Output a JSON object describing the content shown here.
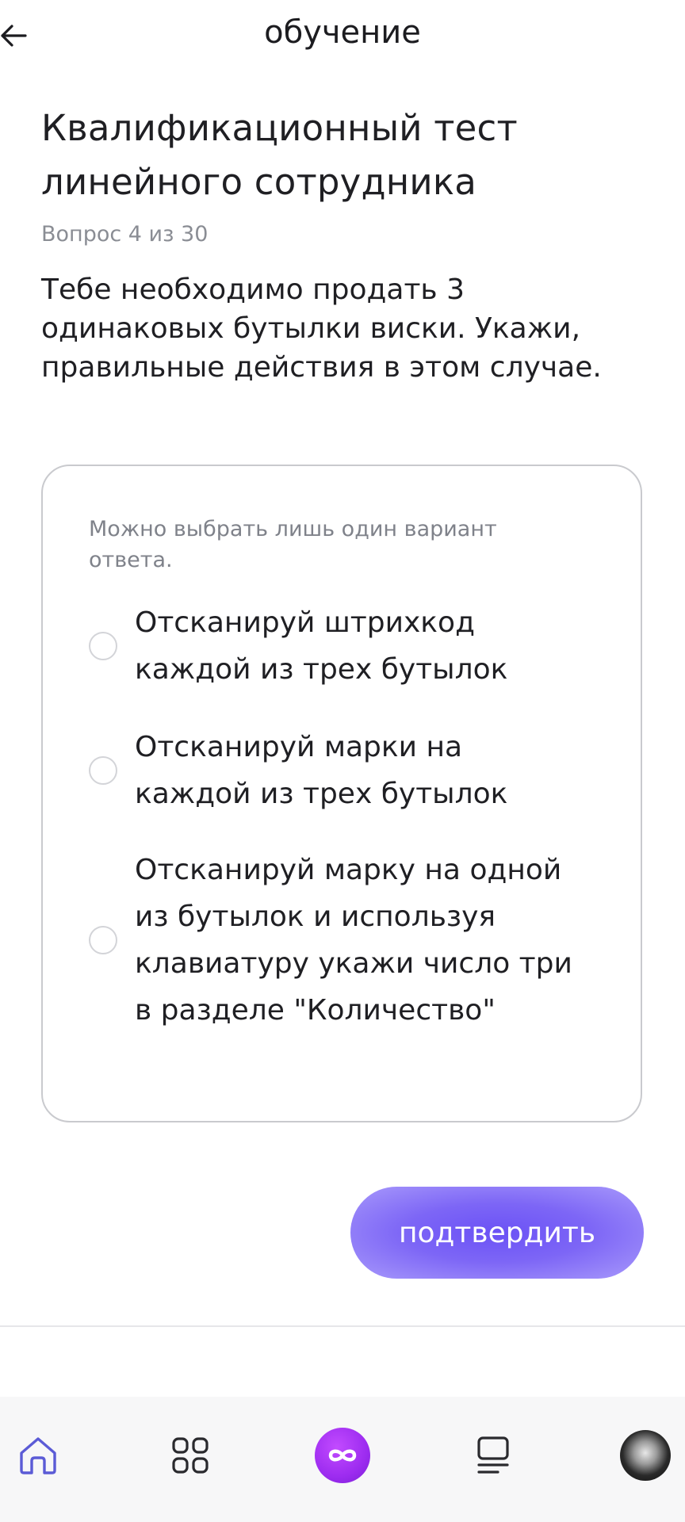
{
  "header": {
    "title": "обучение",
    "back_icon": "arrow-left-icon"
  },
  "test": {
    "title": "Квалификационный тест линейного сотрудника",
    "progress": "Вопрос 4 из 30",
    "question": "Тебе необходимо продать 3 одинаковых бутылки виски. Укажи, правильные действия в этом случае."
  },
  "answers": {
    "hint": "Можно выбрать лишь один вариант ответа.",
    "options": [
      {
        "label": "Отсканируй штрихкод каждой из трех бутылок",
        "selected": false
      },
      {
        "label": "Отсканируй марки на каждой из трех бутылок",
        "selected": false
      },
      {
        "label": "Отсканируй марку на одной из бутылок и используя клавиатуру укажи число три в разделе \"Количество\"",
        "selected": false
      }
    ]
  },
  "confirm": {
    "label": "подтвердить"
  },
  "nav": {
    "items": [
      {
        "icon": "home-icon",
        "active": true
      },
      {
        "icon": "apps-grid-icon",
        "active": false
      },
      {
        "icon": "infinity-icon",
        "active": false
      },
      {
        "icon": "list-icon",
        "active": false
      },
      {
        "icon": "avatar",
        "active": false
      }
    ]
  },
  "colors": {
    "accent": "#6b52f5",
    "nav_active": "#5b5bd6",
    "center_button": "#9d2cf0"
  }
}
